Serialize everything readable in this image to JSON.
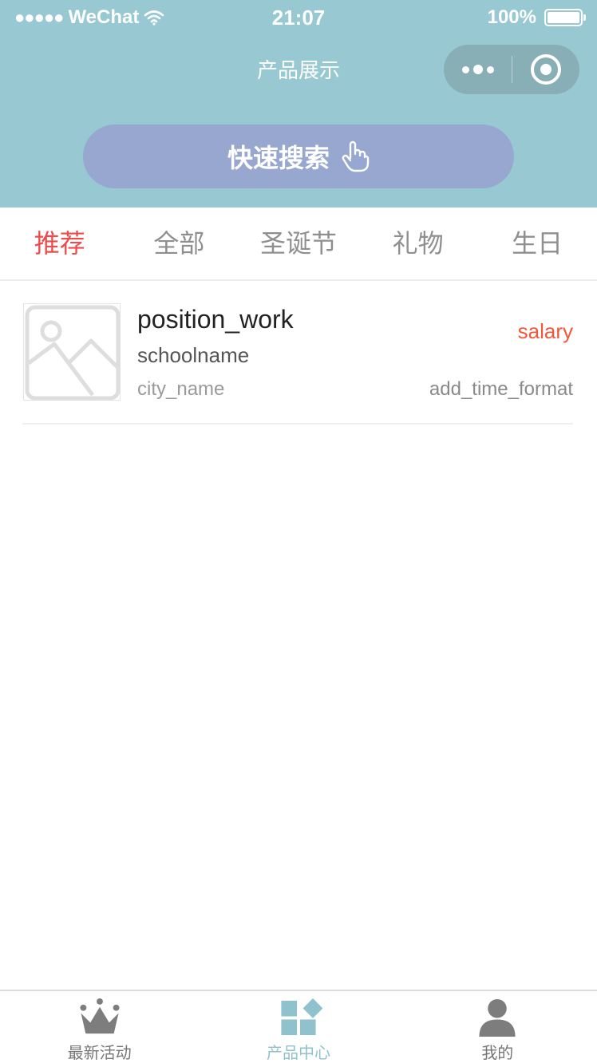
{
  "status_bar": {
    "signal": "●●●●●",
    "carrier": "WeChat",
    "time": "21:07",
    "battery": "100%"
  },
  "nav": {
    "title": "产品展示"
  },
  "search": {
    "label": "快速搜索"
  },
  "tabs": [
    {
      "label": "推荐",
      "active": true
    },
    {
      "label": "全部",
      "active": false
    },
    {
      "label": "圣诞节",
      "active": false
    },
    {
      "label": "礼物",
      "active": false
    },
    {
      "label": "生日",
      "active": false
    }
  ],
  "list": [
    {
      "title": "position_work",
      "subtitle": "schoolname",
      "city": "city_name",
      "salary": "salary",
      "time": "add_time_format",
      "thumbnail_icon": "image-placeholder-icon"
    }
  ],
  "tabbar": [
    {
      "label": "最新活动",
      "icon": "crown-icon",
      "active": false
    },
    {
      "label": "产品中心",
      "icon": "product-grid-icon",
      "active": true
    },
    {
      "label": "我的",
      "icon": "user-icon",
      "active": false
    }
  ],
  "colors": {
    "header_bg": "#98c8d2",
    "search_button_bg": "#97a7d0",
    "active_tab": "#ee4b4b",
    "salary": "#f0583b",
    "tabbar_active": "#8fc2cc",
    "tabbar_inactive": "#8a8a8a"
  }
}
